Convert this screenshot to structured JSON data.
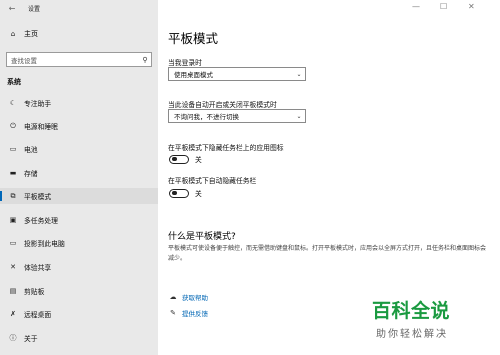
{
  "window": {
    "title": "设置",
    "back_icon": "back-arrow-icon"
  },
  "sidebar": {
    "home_label": "主页",
    "search_placeholder": "查找设置",
    "section_label": "系统",
    "items": [
      {
        "label": "专注助手",
        "icon": "moon-icon"
      },
      {
        "label": "电源和睡眠",
        "icon": "power-icon"
      },
      {
        "label": "电池",
        "icon": "battery-icon"
      },
      {
        "label": "存储",
        "icon": "storage-icon"
      },
      {
        "label": "平板模式",
        "icon": "tablet-mode-icon"
      },
      {
        "label": "多任务处理",
        "icon": "multitasking-icon"
      },
      {
        "label": "投影到此电脑",
        "icon": "project-icon"
      },
      {
        "label": "体验共享",
        "icon": "shared-experiences-icon"
      },
      {
        "label": "剪贴板",
        "icon": "clipboard-icon"
      },
      {
        "label": "远程桌面",
        "icon": "remote-desktop-icon"
      },
      {
        "label": "关于",
        "icon": "info-icon"
      }
    ],
    "active_index": 4
  },
  "main": {
    "title": "平板模式",
    "signin_label": "当我登录时",
    "signin_value": "使用桌面模式",
    "auto_label": "当此设备自动开启或关闭平板模式时",
    "auto_value": "不询问我，不进行切换",
    "hide_icons_label": "在平板模式下隐藏任务栏上的应用图标",
    "hide_icons_state": "关",
    "hide_taskbar_label": "在平板模式下自动隐藏任务栏",
    "hide_taskbar_state": "关",
    "about_heading": "什么是平板模式?",
    "about_desc": "平板模式可使设备便于触控，而无需借助键盘和鼠标。打开平板模式时，应用会以全屏方式打开，且任务栏和桌面图标会减少。",
    "help_link": "获取帮助",
    "feedback_link": "提供反馈"
  },
  "watermark": {
    "main": "百科全说",
    "sub": "助你轻松解决"
  },
  "colors": {
    "accent": "#0067b8",
    "sidebar_bg": "#e9e9e9",
    "watermark": "#1a9a40"
  }
}
